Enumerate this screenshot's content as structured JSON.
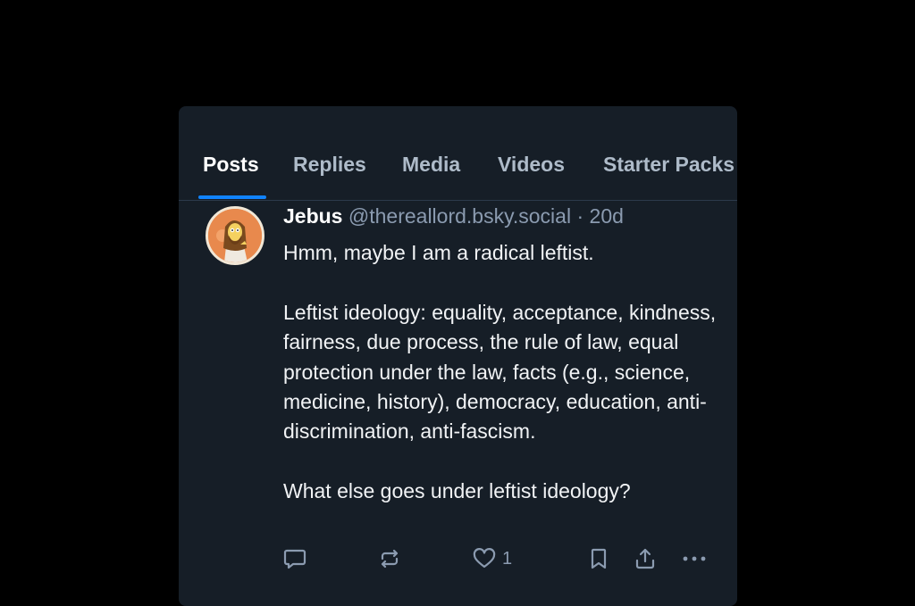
{
  "tabs": [
    {
      "label": "Posts",
      "active": true
    },
    {
      "label": "Replies",
      "active": false
    },
    {
      "label": "Media",
      "active": false
    },
    {
      "label": "Videos",
      "active": false
    },
    {
      "label": "Starter Packs",
      "active": false
    }
  ],
  "post": {
    "display_name": "Jebus",
    "handle": "@thereallord.bsky.social",
    "separator": "·",
    "time": "20d",
    "paragraphs": [
      "Hmm, maybe I am a radical leftist.",
      "Leftist ideology: equality, acceptance, kindness, fairness, due process, the rule of law, equal protection under the law, facts (e.g., science, medicine, history), democracy, education, anti-discrimination, anti-fascism.",
      "What else goes under leftist ideology?"
    ],
    "like_count": "1",
    "avatar_icon": "avatar-jesus-cartoon"
  },
  "icons": {
    "reply": "speech-bubble-icon",
    "repost": "repost-arrows-icon",
    "like": "heart-icon",
    "bookmark": "bookmark-icon",
    "share": "share-upload-icon",
    "more": "ellipsis-icon"
  },
  "colors": {
    "background": "#000000",
    "card": "#161e27",
    "accent": "#1083fe",
    "muted_text": "#8b9bb0",
    "text": "#f1f3f5"
  }
}
